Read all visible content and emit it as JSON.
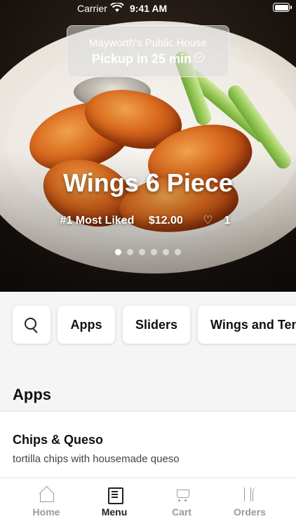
{
  "status_bar": {
    "carrier": "Carrier",
    "time": "9:41 AM"
  },
  "location": {
    "restaurant": "Mayworth's Public House",
    "pickup": "Pickup in 25 min"
  },
  "featured": {
    "title": "Wings 6 Piece",
    "badge": "#1 Most Liked",
    "price": "$12.00",
    "likes": "1",
    "carousel_count": 6,
    "carousel_active_index": 0
  },
  "categories": [
    {
      "label": "Apps"
    },
    {
      "label": "Sliders"
    },
    {
      "label": "Wings and Tenders"
    }
  ],
  "section": {
    "title": "Apps"
  },
  "items": [
    {
      "name": "Chips & Queso",
      "description": "tortilla chips with housemade queso"
    }
  ],
  "tabs": [
    {
      "label": "Home",
      "icon": "home-icon"
    },
    {
      "label": "Menu",
      "icon": "menu-book-icon",
      "active": true
    },
    {
      "label": "Cart",
      "icon": "cart-icon"
    },
    {
      "label": "Orders",
      "icon": "orders-icon"
    }
  ],
  "colors": {
    "accent": "#222222",
    "inactive_tab": "#9a9a9a",
    "background": "#f5f5f5"
  }
}
